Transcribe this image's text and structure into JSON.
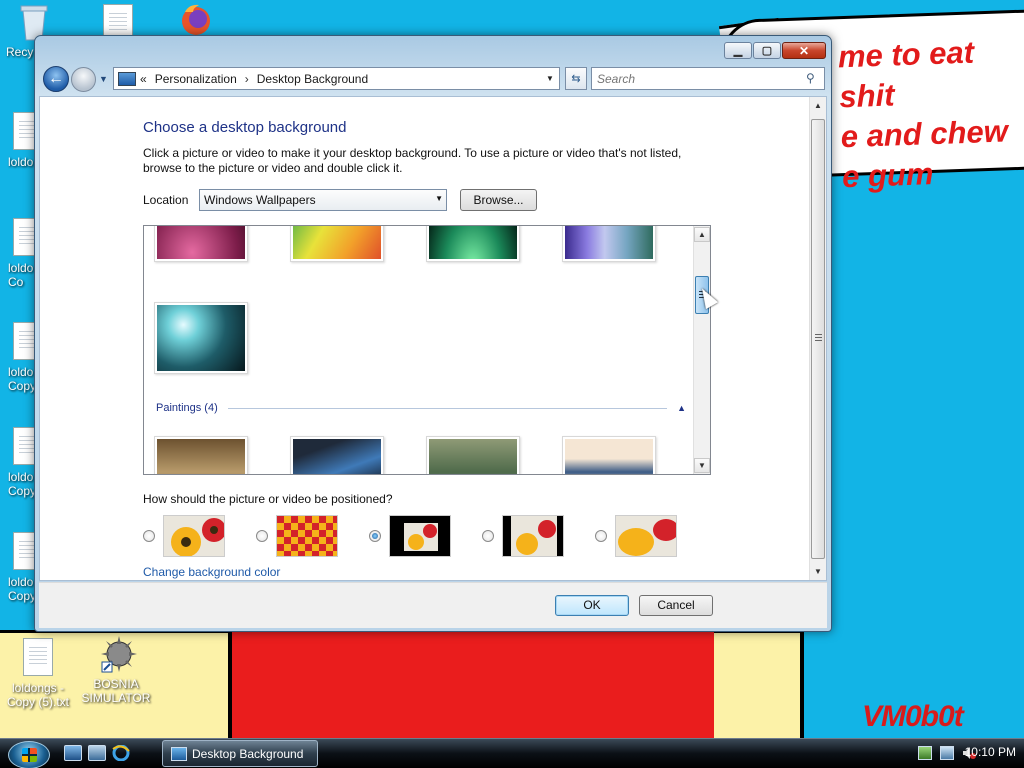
{
  "desktop": {
    "speech_bubble": "me to eat shit\ne and chew\ne gum",
    "signature": "VM0b0t",
    "icons": [
      {
        "label": "Recy"
      },
      {
        "label": "loldo"
      },
      {
        "label": "loldo\nCo"
      },
      {
        "label": "loldo\nCopy"
      },
      {
        "label": "loldo\nCopy"
      },
      {
        "label": "loldo\nCopy"
      },
      {
        "label": "loldongs -\nCopy (5).txt"
      },
      {
        "label": "BOSNIA\nSIMULATOR"
      }
    ]
  },
  "window": {
    "breadcrumb": {
      "root_glyph": "«",
      "items": [
        "Personalization",
        "Desktop Background"
      ],
      "separator": "›"
    },
    "search": {
      "placeholder": "Search"
    },
    "caption": {
      "minimize": "▁",
      "maximize": "▢",
      "close": "✕"
    },
    "title": "Choose a desktop background",
    "description": "Click a picture or video to make it your desktop background. To use a picture or video that's not listed, browse to the picture or video and double click it.",
    "location_label": "Location",
    "location_value": "Windows Wallpapers",
    "browse_label": "Browse...",
    "group_label": "Paintings (4)",
    "position_question": "How should the picture or video be positioned?",
    "position_selected": 2,
    "change_color_label": "Change background color",
    "ok_label": "OK",
    "cancel_label": "Cancel"
  },
  "taskbar": {
    "active_window": "Desktop Background",
    "clock": "10:10 PM"
  },
  "colors": {
    "desktop_bg": "#12b4e6",
    "heading_blue": "#1e3287",
    "link_blue": "#1f5aa8",
    "wallpaper_red": "#ea1d1d"
  },
  "icons": [
    "recycle-bin-icon",
    "text-file-icon",
    "firefox-icon",
    "back-arrow-icon",
    "forward-arrow-icon",
    "control-panel-icon",
    "refresh-icon",
    "search-icon",
    "collapse-chevron-icon",
    "start-orb-icon",
    "show-desktop-icon",
    "switch-windows-icon",
    "internet-explorer-icon",
    "network-icon",
    "volume-muted-icon"
  ]
}
